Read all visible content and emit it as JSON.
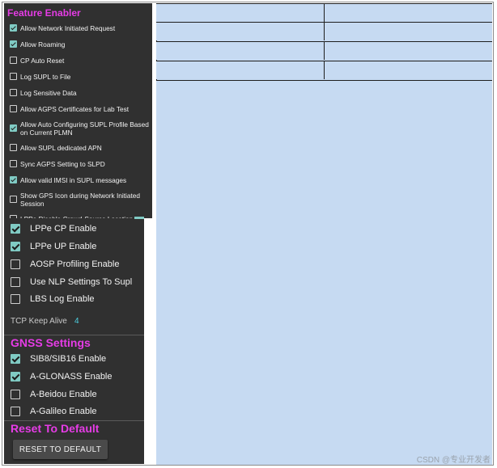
{
  "feature_enabler": {
    "title": "Feature Enabler",
    "items": [
      {
        "label": "Allow Network Initiated Request",
        "checked": true
      },
      {
        "label": "Allow Roaming",
        "checked": true
      },
      {
        "label": "CP Auto Reset",
        "checked": false
      },
      {
        "label": "Log SUPL to File",
        "checked": false
      },
      {
        "label": "Log Sensitive Data",
        "checked": false
      },
      {
        "label": "Allow AGPS Certificates for Lab Test",
        "checked": false
      },
      {
        "label": "Allow Auto Configuring SUPL Profile Based on Current PLMN",
        "checked": true
      },
      {
        "label": "Allow SUPL dedicated APN",
        "checked": false
      },
      {
        "label": "Sync AGPS Setting to SLPD",
        "checked": false
      },
      {
        "label": "Allow valid IMSI in SUPL messages",
        "checked": true
      },
      {
        "label": "Show GPS Icon during Network Initiated Session",
        "checked": false
      },
      {
        "label": "LPPe Disable Crowd-Source Location",
        "checked": false
      }
    ]
  },
  "lppe_items": [
    {
      "label": "LPPe CP Enable",
      "checked": true
    },
    {
      "label": "LPPe UP Enable",
      "checked": true
    },
    {
      "label": "AOSP Profiling Enable",
      "checked": false
    },
    {
      "label": "Use NLP Settings To Supl",
      "checked": false
    },
    {
      "label": "LBS Log Enable",
      "checked": false
    }
  ],
  "tcp_keep_alive": {
    "label": "TCP Keep Alive",
    "value": "4"
  },
  "gnss_settings": {
    "title": "GNSS Settings",
    "items": [
      {
        "label": "SIB8/SIB16 Enable",
        "checked": true
      },
      {
        "label": "A-GLONASS Enable",
        "checked": true
      },
      {
        "label": "A-Beidou Enable",
        "checked": false
      },
      {
        "label": "A-Galileo Enable",
        "checked": false
      }
    ]
  },
  "reset": {
    "title": "Reset To Default",
    "button_label": "RESET TO DEFAULT"
  },
  "grid": {
    "rows": 4,
    "columns": 2
  },
  "watermark": "CSDN @专业开发者",
  "colors": {
    "panel_bg": "#303030",
    "title_magenta": "#e63ce6",
    "checkbox_teal": "#80cbc4",
    "value_cyan": "#4dd0e1",
    "right_bg": "#c6daf2"
  }
}
